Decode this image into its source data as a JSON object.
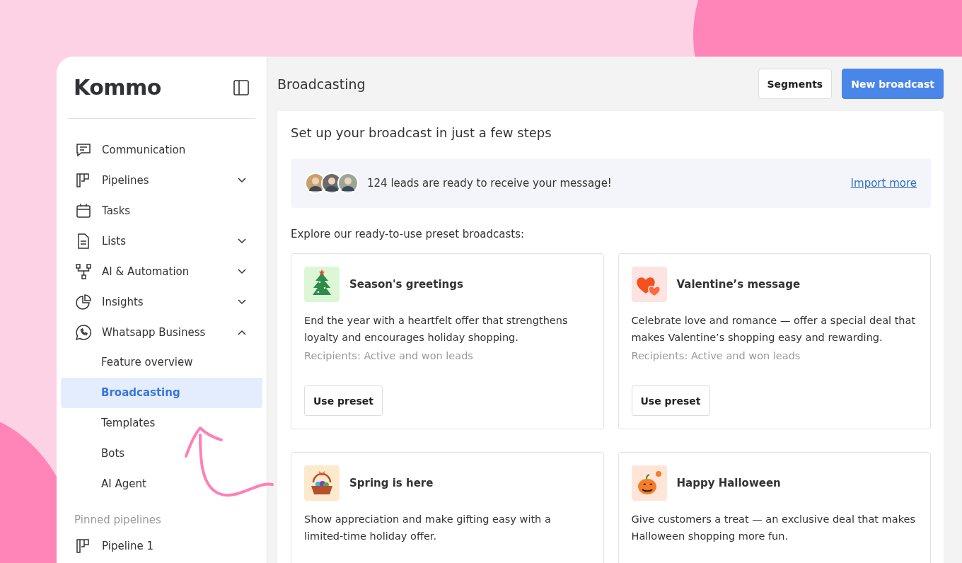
{
  "sidebar": {
    "logo": "Kommo",
    "nav": [
      {
        "label": "Communication",
        "kind": "chat"
      },
      {
        "label": "Pipelines",
        "kind": "pipeline",
        "expanded": false
      },
      {
        "label": "Tasks",
        "kind": "calendar"
      },
      {
        "label": "Lists",
        "kind": "document",
        "expanded": false
      },
      {
        "label": "AI & Automation",
        "kind": "flow",
        "expanded": false
      },
      {
        "label": "Insights",
        "kind": "pie",
        "expanded": false
      },
      {
        "label": "Whatsapp Business",
        "kind": "whatsapp",
        "expanded": true,
        "children": [
          {
            "label": "Feature overview",
            "selected": false
          },
          {
            "label": "Broadcasting",
            "selected": true
          },
          {
            "label": "Templates",
            "selected": false
          },
          {
            "label": "Bots",
            "selected": false
          },
          {
            "label": "AI Agent",
            "selected": false
          }
        ]
      }
    ],
    "pinned": {
      "heading": "Pinned pipelines",
      "items": [
        {
          "label": "Pipeline 1",
          "kind": "pipeline"
        }
      ]
    }
  },
  "header": {
    "title": "Broadcasting",
    "buttons": [
      {
        "label": "Segments",
        "kind": "secondary"
      },
      {
        "label": "New broadcast",
        "kind": "primary"
      }
    ]
  },
  "panel": {
    "heading": "Set up your broadcast in just a few steps",
    "leads": {
      "text": "124 leads are ready to receive your message!",
      "link": "Import more"
    },
    "explore": "Explore our ready-to-use preset broadcasts:",
    "presets": [
      {
        "kind": "tree",
        "title": "Season's greetings",
        "description": "End the year with a heartfelt offer that strengthens loyalty and encourages holiday shopping.",
        "recipients": "Recipients: Active and won leads",
        "button": "Use preset"
      },
      {
        "kind": "hearts",
        "title": "Valentine’s message",
        "description": "Celebrate love and romance — offer a special deal that makes Valentine’s shopping easy and rewarding.",
        "recipients": "Recipients: Active and won leads",
        "button": "Use preset"
      },
      {
        "kind": "basket",
        "title": "Spring is here",
        "description": "Show appreciation and make gifting easy with a limited-time holiday offer."
      },
      {
        "kind": "pumpkin",
        "title": "Happy Halloween",
        "description": "Give customers a treat — an exclusive deal that makes Halloween shopping more fun."
      }
    ]
  }
}
